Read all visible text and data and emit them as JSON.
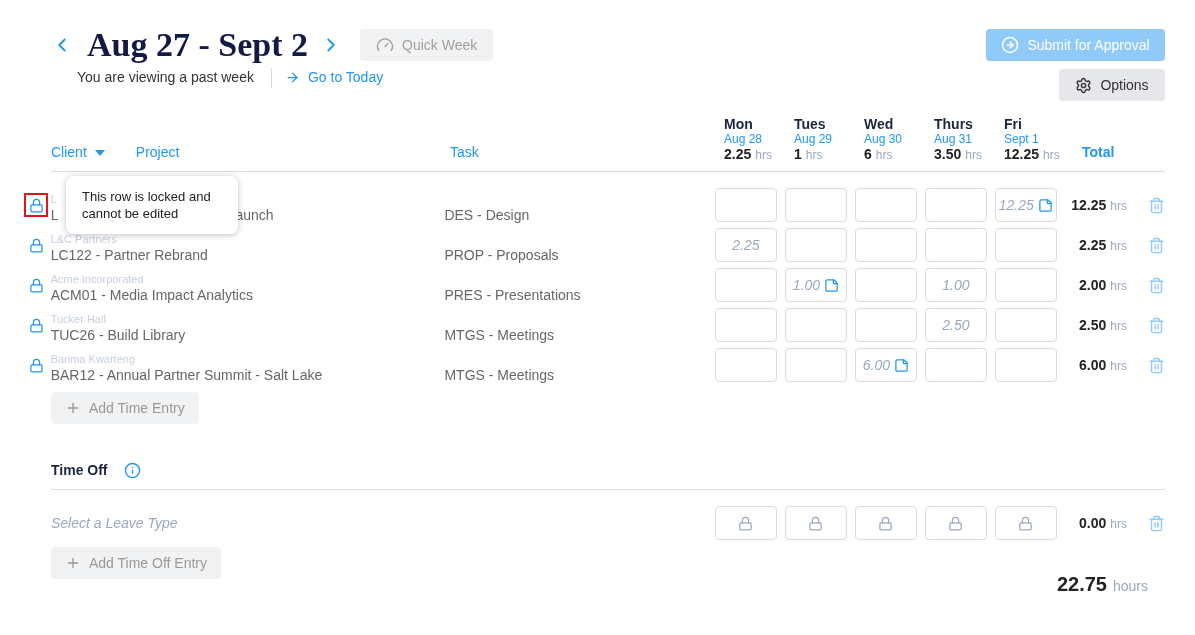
{
  "header": {
    "title": "Aug 27 - Sept 2",
    "quick_week": {
      "label": "Quick Week",
      "disabled": true
    },
    "notice": "You are viewing a past week",
    "go_today": "Go to Today",
    "submit": {
      "label": "Submit for Approval",
      "disabled": true
    },
    "options": "Options"
  },
  "columns": {
    "client": "Client",
    "project": "Project",
    "task": "Task",
    "total": "Total"
  },
  "days": [
    {
      "name": "Mon",
      "date": "Aug 28",
      "hours": "2.25",
      "unit": "hrs"
    },
    {
      "name": "Tues",
      "date": "Aug 29",
      "hours": "1",
      "unit": "hrs"
    },
    {
      "name": "Wed",
      "date": "Aug 30",
      "hours": "6",
      "unit": "hrs"
    },
    {
      "name": "Thurs",
      "date": "Aug 31",
      "hours": "3.50",
      "unit": "hrs"
    },
    {
      "name": "Fri",
      "date": "Sept 1",
      "hours": "12.25",
      "unit": "hrs"
    }
  ],
  "rows": [
    {
      "client": "L",
      "project": "L",
      "project_tail": "aunch",
      "task": "DES - Design",
      "locked": true,
      "highlighted": true,
      "cells": [
        {
          "note": false
        },
        {
          "note": false
        },
        {
          "note": false
        },
        {
          "note": false
        },
        {
          "value": "12.25",
          "note": true
        }
      ],
      "total": "12.25",
      "unit": "hrs"
    },
    {
      "client": "L&C Partners",
      "project": "LC122 - Partner Rebrand",
      "task": "PROP - Proposals",
      "locked": true,
      "highlighted": false,
      "cells": [
        {
          "value": "2.25",
          "note": false
        },
        {
          "note": false
        },
        {
          "note": false
        },
        {
          "note": false
        },
        {
          "note": false
        }
      ],
      "total": "2.25",
      "unit": "hrs"
    },
    {
      "client": "Acme Incorporated",
      "project": "ACM01 - Media Impact Analytics",
      "task": "PRES - Presentations",
      "locked": true,
      "highlighted": false,
      "cells": [
        {
          "note": false
        },
        {
          "value": "1.00",
          "note": true
        },
        {
          "note": false
        },
        {
          "value": "1.00",
          "note": false
        },
        {
          "note": false
        }
      ],
      "total": "2.00",
      "unit": "hrs"
    },
    {
      "client": "Tucker Hall",
      "project": "TUC26 - Build Library",
      "task": "MTGS - Meetings",
      "locked": true,
      "highlighted": false,
      "cells": [
        {
          "note": false
        },
        {
          "note": false
        },
        {
          "note": false
        },
        {
          "value": "2.50",
          "note": false
        },
        {
          "note": false
        }
      ],
      "total": "2.50",
      "unit": "hrs"
    },
    {
      "client": "Barima Kwarteng",
      "project": "BAR12 - Annual Partner Summit - Salt Lake",
      "task": "MTGS - Meetings",
      "locked": true,
      "highlighted": false,
      "cells": [
        {
          "note": false
        },
        {
          "note": false
        },
        {
          "value": "6.00",
          "note": true
        },
        {
          "note": false
        },
        {
          "note": false
        }
      ],
      "total": "6.00",
      "unit": "hrs"
    }
  ],
  "tooltip": {
    "text": "This row is locked and cannot be edited"
  },
  "add_entry": "Add Time Entry",
  "time_off": {
    "title": "Time Off",
    "placeholder": "Select a Leave Type",
    "cells": [
      {
        "locked": true
      },
      {
        "locked": true
      },
      {
        "locked": true
      },
      {
        "locked": true
      },
      {
        "locked": true
      }
    ],
    "total": "0.00",
    "unit": "hrs",
    "add": "Add Time Off Entry"
  },
  "grand_total": {
    "value": "22.75",
    "unit": "hours"
  }
}
